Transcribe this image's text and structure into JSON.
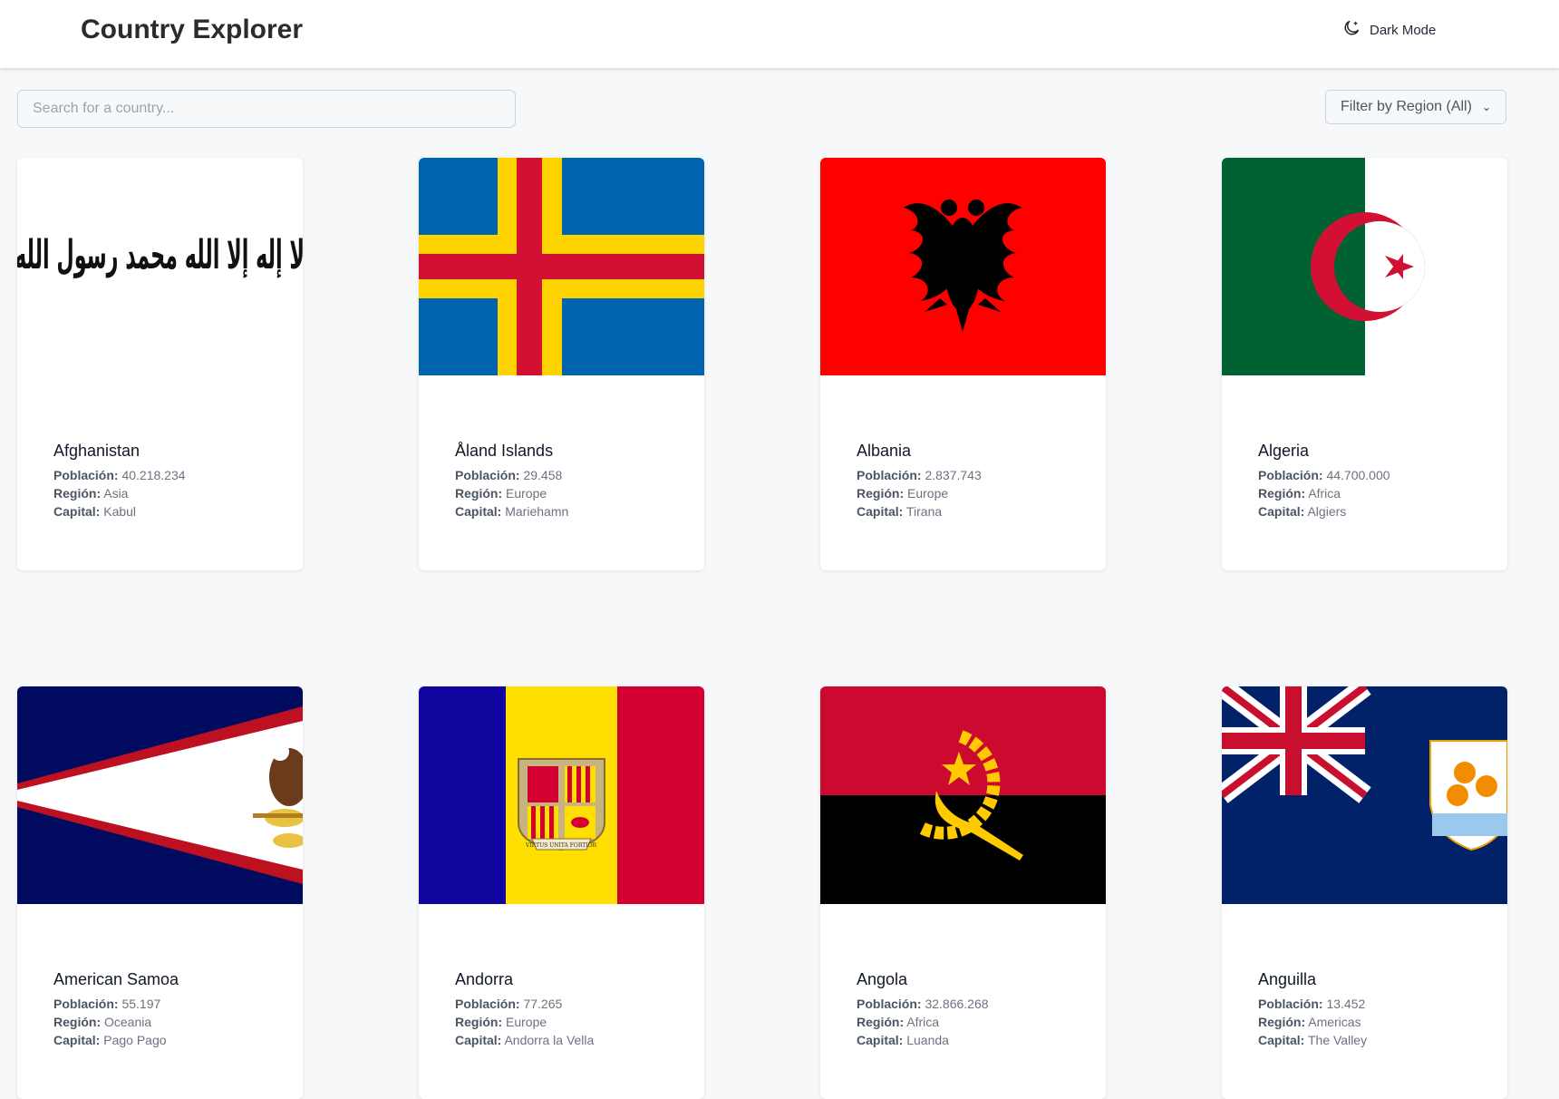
{
  "header": {
    "title": "Country Explorer",
    "dark_mode_label": "Dark Mode"
  },
  "search": {
    "placeholder": "Search for a country..."
  },
  "filter": {
    "label": "Filter by Region (All)"
  },
  "labels": {
    "population": "Población:",
    "region": "Región:",
    "capital": "Capital:"
  },
  "countries": [
    {
      "name": "Afghanistan",
      "population": "40.218.234",
      "region": "Asia",
      "capital": "Kabul",
      "flag_text": "لا إله إلا الله محمد رسول الله"
    },
    {
      "name": "Åland Islands",
      "population": "29.458",
      "region": "Europe",
      "capital": "Mariehamn"
    },
    {
      "name": "Albania",
      "population": "2.837.743",
      "region": "Europe",
      "capital": "Tirana"
    },
    {
      "name": "Algeria",
      "population": "44.700.000",
      "region": "Africa",
      "capital": "Algiers"
    },
    {
      "name": "American Samoa",
      "population": "55.197",
      "region": "Oceania",
      "capital": "Pago Pago"
    },
    {
      "name": "Andorra",
      "population": "77.265",
      "region": "Europe",
      "capital": "Andorra la Vella",
      "flag_text": "VIRTUS UNITA FORTIOR"
    },
    {
      "name": "Angola",
      "population": "32.866.268",
      "region": "Africa",
      "capital": "Luanda"
    },
    {
      "name": "Anguilla",
      "population": "13.452",
      "region": "Americas",
      "capital": "The Valley"
    }
  ],
  "colors": {
    "background": "#f7f8fa",
    "header": "#ffffff",
    "card": "#ffffff"
  }
}
